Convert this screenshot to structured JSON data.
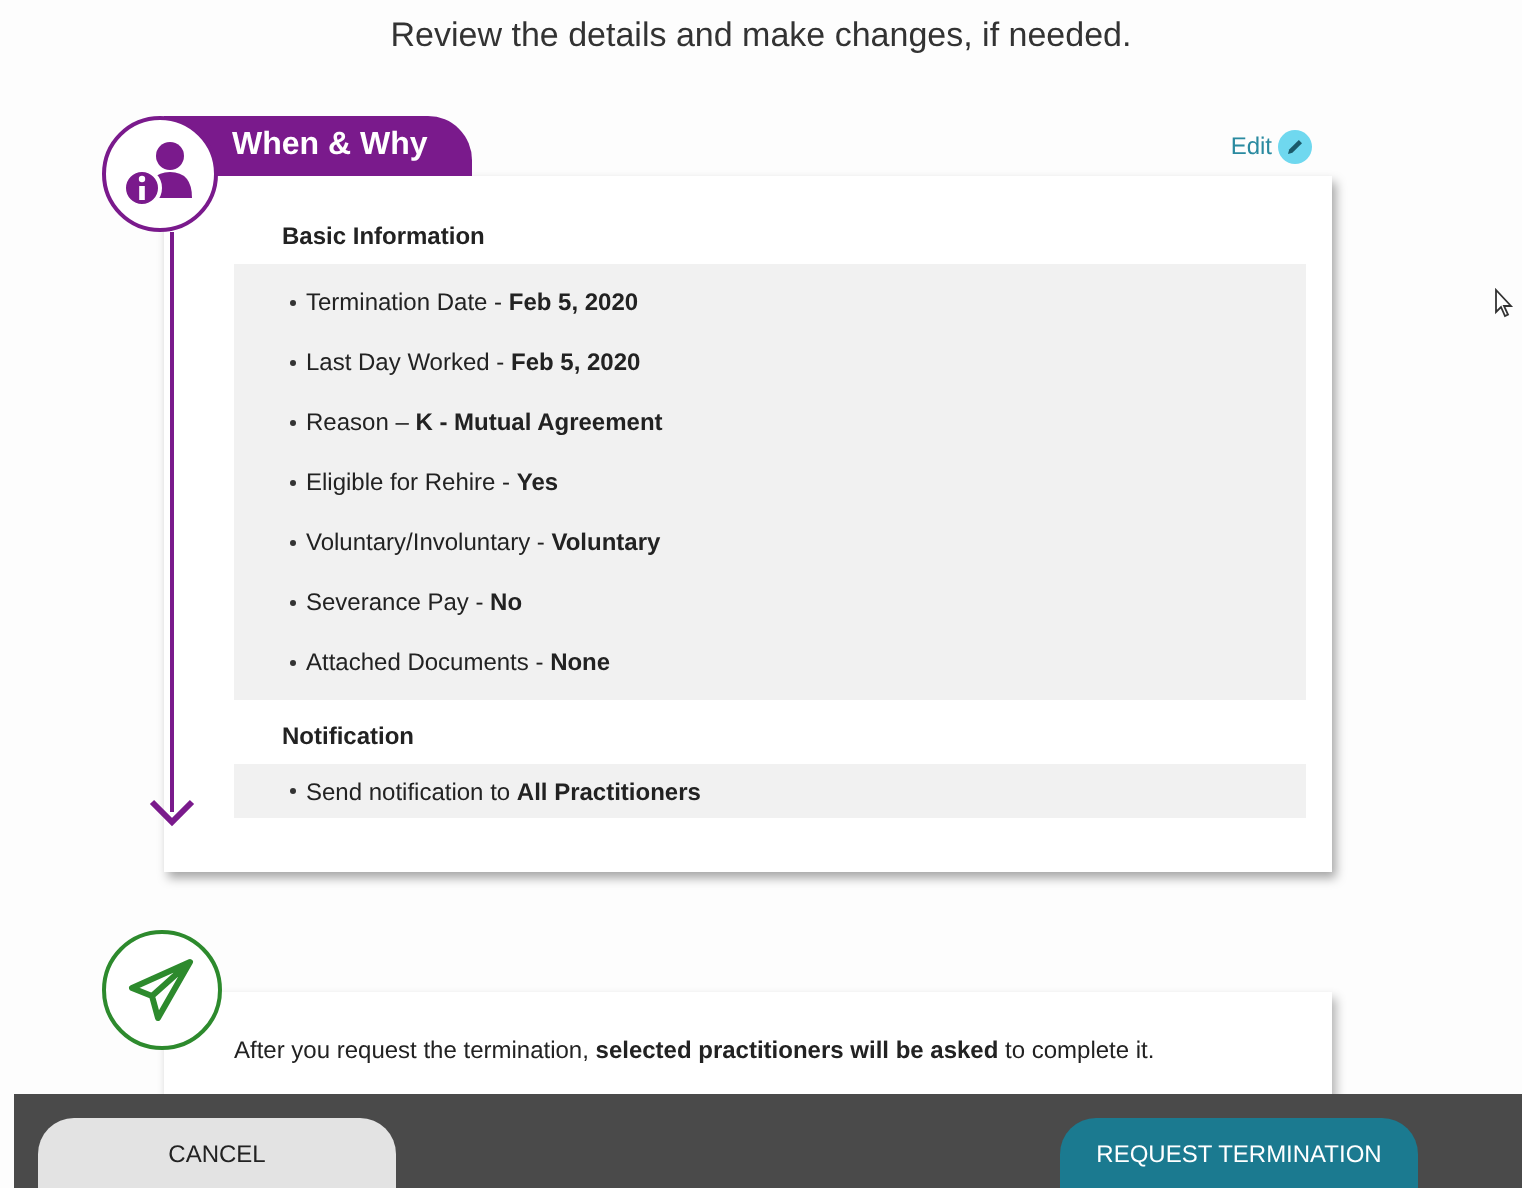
{
  "header": {
    "subtitle": "Review the details and make changes, if needed."
  },
  "sections": [
    {
      "kind": "details",
      "title": "When & Why",
      "edit_label": "Edit",
      "groups": [
        {
          "heading": "Basic Information",
          "items": [
            "Termination Date - **Feb 5, 2020**",
            "Last Day Worked - **Feb 5, 2020**",
            "Reason – **K - Mutual Agreement**",
            "Eligible for Rehire - **Yes**",
            "Voluntary/Involuntary - **Voluntary**",
            "Severance Pay - **No**",
            "Attached Documents - **None**"
          ]
        },
        {
          "heading": "Notification",
          "items": [
            "Send notification to **All Practitioners**"
          ]
        }
      ]
    },
    {
      "kind": "notice",
      "text": "After you request the termination, **selected practitioners will be asked** to complete it."
    }
  ],
  "footer": {
    "buttons": [
      {
        "label": "CANCEL",
        "kind": "secondary"
      },
      {
        "label": "REQUEST TERMINATION",
        "kind": "primary"
      }
    ]
  }
}
